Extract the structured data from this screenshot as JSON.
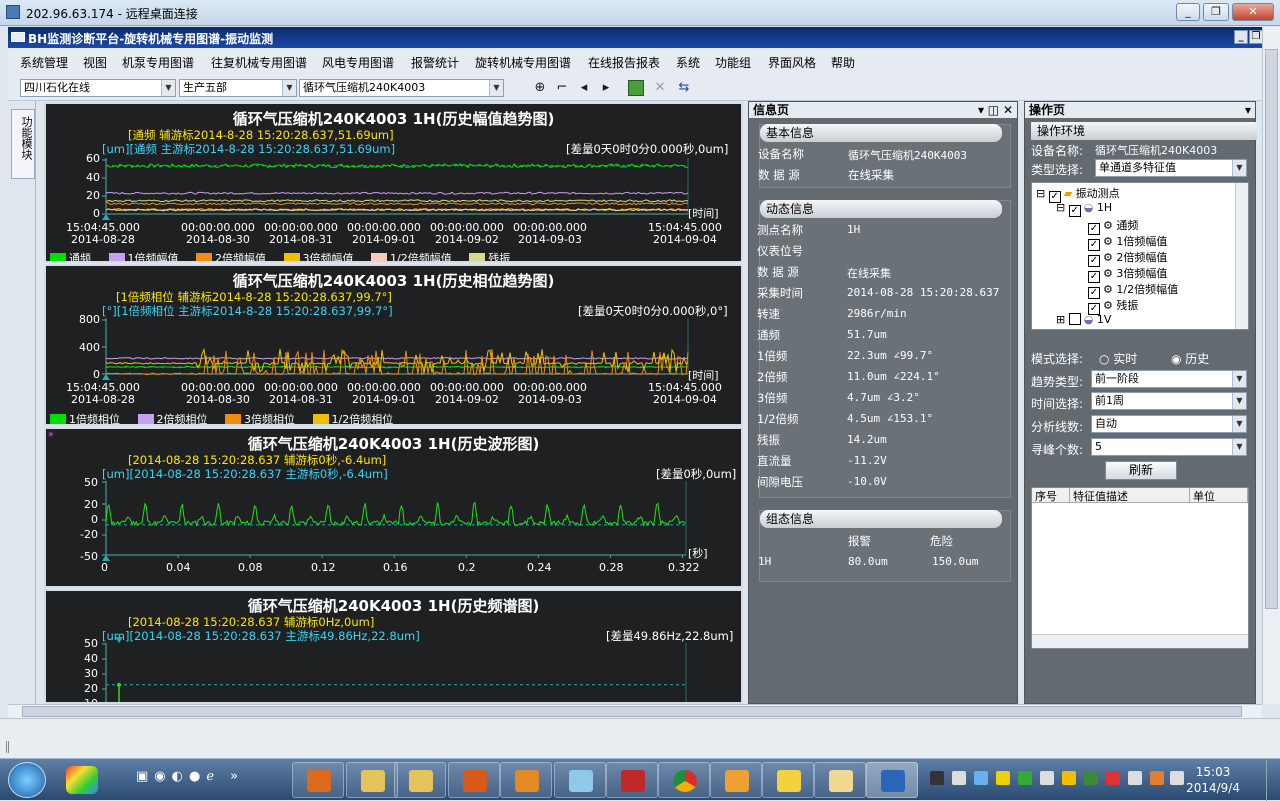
{
  "rdp": {
    "title": "202.96.63.174 - 远程桌面连接"
  },
  "app": {
    "title": "BH监测诊断平台-旋转机械专用图谱-振动监测"
  },
  "menu": [
    "系统管理",
    "视图",
    "机泵专用图谱",
    "往复机械专用图谱",
    "风电专用图谱",
    "报警统计",
    "旋转机械专用图谱",
    "在线报告报表",
    "系统",
    "功能组",
    "界面风格",
    "帮助"
  ],
  "toolbar": {
    "company": "四川石化在线",
    "department": "生产五部",
    "device": "循环气压缩机240K4003"
  },
  "leftstrip": {
    "tab": "功能模块"
  },
  "charts": {
    "amp": {
      "title": "循环气压缩机240K4003 1H(历史幅值趋势图)",
      "aux": "[通频 辅游标2014-8-28 15:20:28.637,51.69um]",
      "main": "[um][通频 主游标2014-8-28 15:20:28.637,51.69um]",
      "diff": "[差量0天0时0分0.000秒,0um]",
      "unit_x": "[时间]",
      "y_ticks": [
        "60",
        "40",
        "20",
        "0"
      ],
      "x_ticks": [
        {
          "a": "15:04:45.000",
          "b": "2014-08-28"
        },
        {
          "a": "00:00:00.000",
          "b": "2014-08-30"
        },
        {
          "a": "00:00:00.000",
          "b": "2014-08-31"
        },
        {
          "a": "00:00:00.000",
          "b": "2014-09-01"
        },
        {
          "a": "00:00:00.000",
          "b": "2014-09-02"
        },
        {
          "a": "00:00:00.000",
          "b": "2014-09-03"
        },
        {
          "a": "15:04:45.000",
          "b": "2014-09-04"
        }
      ],
      "legend": [
        {
          "name": "通频",
          "color": "#00e000"
        },
        {
          "name": "1倍频幅值",
          "color": "#c8a0f0"
        },
        {
          "name": "2倍频幅值",
          "color": "#f08c10"
        },
        {
          "name": "3倍频幅值",
          "color": "#f0c000"
        },
        {
          "name": "1/2倍频幅值",
          "color": "#f5c8c0"
        },
        {
          "name": "残振",
          "color": "#d8d890"
        }
      ]
    },
    "phase": {
      "title": "循环气压缩机240K4003 1H(历史相位趋势图)",
      "aux": "[1倍频相位 辅游标2014-8-28 15:20:28.637,99.7°]",
      "main": "[°][1倍频相位 主游标2014-8-28 15:20:28.637,99.7°]",
      "diff": "[差量0天0时0分0.000秒,0°]",
      "unit_x": "[时间]",
      "y_ticks": [
        "800",
        "400",
        "0"
      ],
      "x_ticks": [
        {
          "a": "15:04:45.000",
          "b": "2014-08-28"
        },
        {
          "a": "00:00:00.000",
          "b": "2014-08-30"
        },
        {
          "a": "00:00:00.000",
          "b": "2014-08-31"
        },
        {
          "a": "00:00:00.000",
          "b": "2014-09-01"
        },
        {
          "a": "00:00:00.000",
          "b": "2014-09-02"
        },
        {
          "a": "00:00:00.000",
          "b": "2014-09-03"
        },
        {
          "a": "15:04:45.000",
          "b": "2014-09-04"
        }
      ],
      "legend": [
        {
          "name": "1倍频相位",
          "color": "#00e000"
        },
        {
          "name": "2倍频相位",
          "color": "#c8a0f0"
        },
        {
          "name": "3倍频相位",
          "color": "#f08c10"
        },
        {
          "name": "1/2倍频相位",
          "color": "#f0c000"
        }
      ]
    },
    "wave": {
      "title": "循环气压缩机240K4003 1H(历史波形图)",
      "aux": "[2014-08-28 15:20:28.637 辅游标0秒,-6.4um]",
      "main": "[um][2014-08-28 15:20:28.637 主游标0秒,-6.4um]",
      "diff": "[差量0秒,0um]",
      "unit_x": "[秒]",
      "y_ticks": [
        "50",
        "20",
        "0",
        "-20",
        "-50"
      ],
      "x_ticks": [
        "0",
        "0.04",
        "0.08",
        "0.12",
        "0.16",
        "0.2",
        "0.24",
        "0.28",
        "0.322"
      ]
    },
    "spec": {
      "title": "循环气压缩机240K4003 1H(历史频谱图)",
      "aux": "[2014-08-28 15:20:28.637 辅游标0Hz,0um]",
      "main": "[um][2014-08-28 15:20:28.637 主游标49.86Hz,22.8um]",
      "diff": "[差量49.86Hz,22.8um]",
      "y_ticks": [
        "50",
        "40",
        "30",
        "20",
        "10"
      ]
    }
  },
  "chart_data": [
    {
      "type": "line",
      "title": "循环气压缩机240K4003 1H(历史幅值趋势图)",
      "ylabel": "um",
      "xlabel": "时间",
      "ylim": [
        0,
        60
      ],
      "x_range": [
        "2014-08-28 15:04:45",
        "2014-09-04 15:04:45"
      ],
      "series": [
        {
          "name": "通频",
          "approx_level": 51.7
        },
        {
          "name": "1倍频幅值",
          "approx_level": 22.3
        },
        {
          "name": "2倍频幅值",
          "approx_level": 11.0
        },
        {
          "name": "3倍频幅值",
          "approx_level": 4.7
        },
        {
          "name": "1/2倍频幅值",
          "approx_level": 4.5
        },
        {
          "name": "残振",
          "approx_level": 14.2
        }
      ]
    },
    {
      "type": "line",
      "title": "循环气压缩机240K4003 1H(历史相位趋势图)",
      "ylabel": "°",
      "xlabel": "时间",
      "ylim": [
        0,
        800
      ],
      "series": [
        {
          "name": "1倍频相位",
          "approx_level": 99.7
        },
        {
          "name": "2倍频相位",
          "approx_level": 224.1
        },
        {
          "name": "3倍频相位",
          "approx_level": 3.2
        },
        {
          "name": "1/2倍频相位",
          "approx_level": 153.1
        }
      ]
    },
    {
      "type": "line",
      "title": "循环气压缩机240K4003 1H(历史波形图)",
      "ylabel": "um",
      "xlabel": "秒",
      "xlim": [
        0,
        0.322
      ],
      "ylim": [
        -50,
        50
      ],
      "series": [
        {
          "name": "波形",
          "period_s": 0.0203,
          "peak_um": 25,
          "trough_um": -8
        }
      ]
    },
    {
      "type": "line",
      "title": "循环气压缩机240K4003 1H(历史频谱图)",
      "ylabel": "um",
      "xlabel": "Hz",
      "ylim": [
        0,
        50
      ],
      "series": [
        {
          "name": "频谱",
          "points": [
            [
              49.86,
              22.8
            ]
          ]
        }
      ]
    }
  ],
  "info": {
    "header": "信息页",
    "basic": {
      "head": "基本信息",
      "rows": [
        {
          "k": "设备名称",
          "v": "循环气压缩机240K4003"
        },
        {
          "k": "数 据 源",
          "v": "在线采集"
        }
      ]
    },
    "dynamic": {
      "head": "动态信息",
      "rows": [
        {
          "k": "测点名称",
          "v": "1H"
        },
        {
          "k": "仪表位号",
          "v": ""
        },
        {
          "k": "数 据 源",
          "v": "在线采集"
        },
        {
          "k": "采集时间",
          "v": "2014-08-28 15:20:28.637"
        },
        {
          "k": "转速",
          "v": "2986r/min"
        },
        {
          "k": "通频",
          "v": "51.7um"
        },
        {
          "k": "1倍频",
          "v": "22.3um ∠99.7°"
        },
        {
          "k": "2倍频",
          "v": "11.0um ∠224.1°"
        },
        {
          "k": "3倍频",
          "v": "4.7um ∠3.2°"
        },
        {
          "k": "1/2倍频",
          "v": "4.5um ∠153.1°"
        },
        {
          "k": "残振",
          "v": "14.2um"
        },
        {
          "k": "直流量",
          "v": "-11.2V"
        },
        {
          "k": "间隙电压",
          "v": "-10.0V"
        }
      ]
    },
    "config": {
      "head": "组态信息",
      "col1": "报警",
      "col2": "危险",
      "row": {
        "k": "1H",
        "v1": "80.0um",
        "v2": "150.0um"
      }
    }
  },
  "ops": {
    "header": "操作页",
    "env": "操作环境",
    "device_label": "设备名称:",
    "device": "循环气压缩机240K4003",
    "type_label": "类型选择:",
    "type": "单通道多特征值",
    "tree": {
      "root": "振动测点",
      "node": "1H",
      "items": [
        "通频",
        "1倍频幅值",
        "2倍频幅值",
        "3倍频幅值",
        "1/2倍频幅值",
        "残振"
      ],
      "next": "1V"
    },
    "mode_label": "模式选择:",
    "mode_rt": "实时",
    "mode_hist": "历史",
    "trend_label": "趋势类型:",
    "trend": "前一阶段",
    "time_label": "时间选择:",
    "time": "前1周",
    "lines_label": "分析线数:",
    "lines": "自动",
    "peaks_label": "寻峰个数:",
    "peaks": "5",
    "refresh": "刷新",
    "table_cols": [
      "序号",
      "特征值描述",
      "单位"
    ]
  },
  "taskbar": {
    "time": "15:03",
    "date": "2014/9/4"
  }
}
